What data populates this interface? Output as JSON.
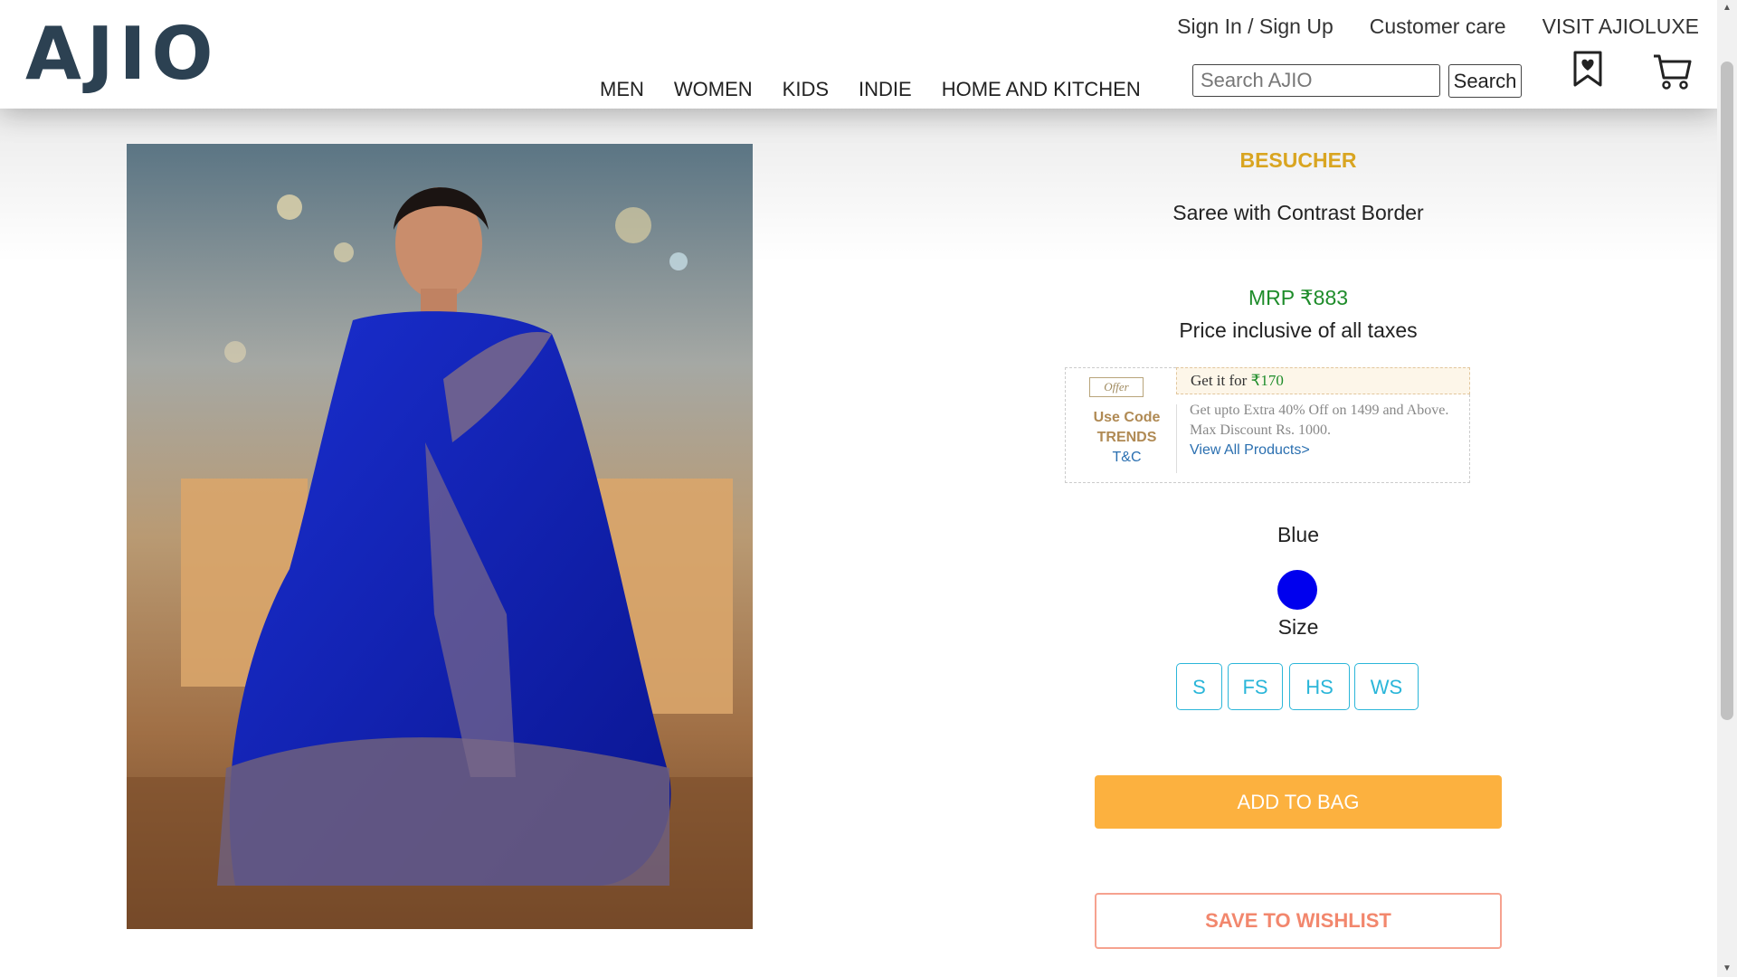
{
  "header": {
    "logo": "AJIO",
    "top_links": [
      "Sign In / Sign Up",
      "Customer care",
      "VISIT AJIOLUXE"
    ],
    "nav": [
      "MEN",
      "WOMEN",
      "KIDS",
      "INDIE",
      "HOME AND KITCHEN"
    ],
    "search_placeholder": "Search AJIO",
    "search_button": "Search",
    "icons": [
      "wishlist-bookmark-icon",
      "cart-icon"
    ]
  },
  "product": {
    "brand": "BESUCHER",
    "name": "Saree with Contrast Border",
    "mrp": "MRP ₹883",
    "taxes": "Price inclusive of all taxes",
    "image_alt": "Blue saree with contrast border",
    "color_name": "Blue",
    "color_hex": "#0000ee",
    "size_label": "Size",
    "sizes": [
      "S",
      "FS",
      "HS",
      "WS"
    ],
    "add_to_bag": "ADD TO BAG",
    "save_to_wishlist": "SAVE TO WISHLIST"
  },
  "offer": {
    "tag": "Offer",
    "use_code_label": "Use Code",
    "code": "TRENDS",
    "tc": "T&C",
    "get_it_for_label": "Get it for",
    "get_it_for_amount": "₹170",
    "description": "Get upto Extra 40% Off on 1499 and Above. Max Discount Rs. 1000.",
    "link": "View All Products>"
  },
  "colors": {
    "brand_gold": "#d9a521",
    "price_green": "#1e8c2a",
    "size_cyan": "#2bb6d9",
    "add_bag_orange": "#fcb13f",
    "wishlist_salmon": "#f2876d"
  }
}
